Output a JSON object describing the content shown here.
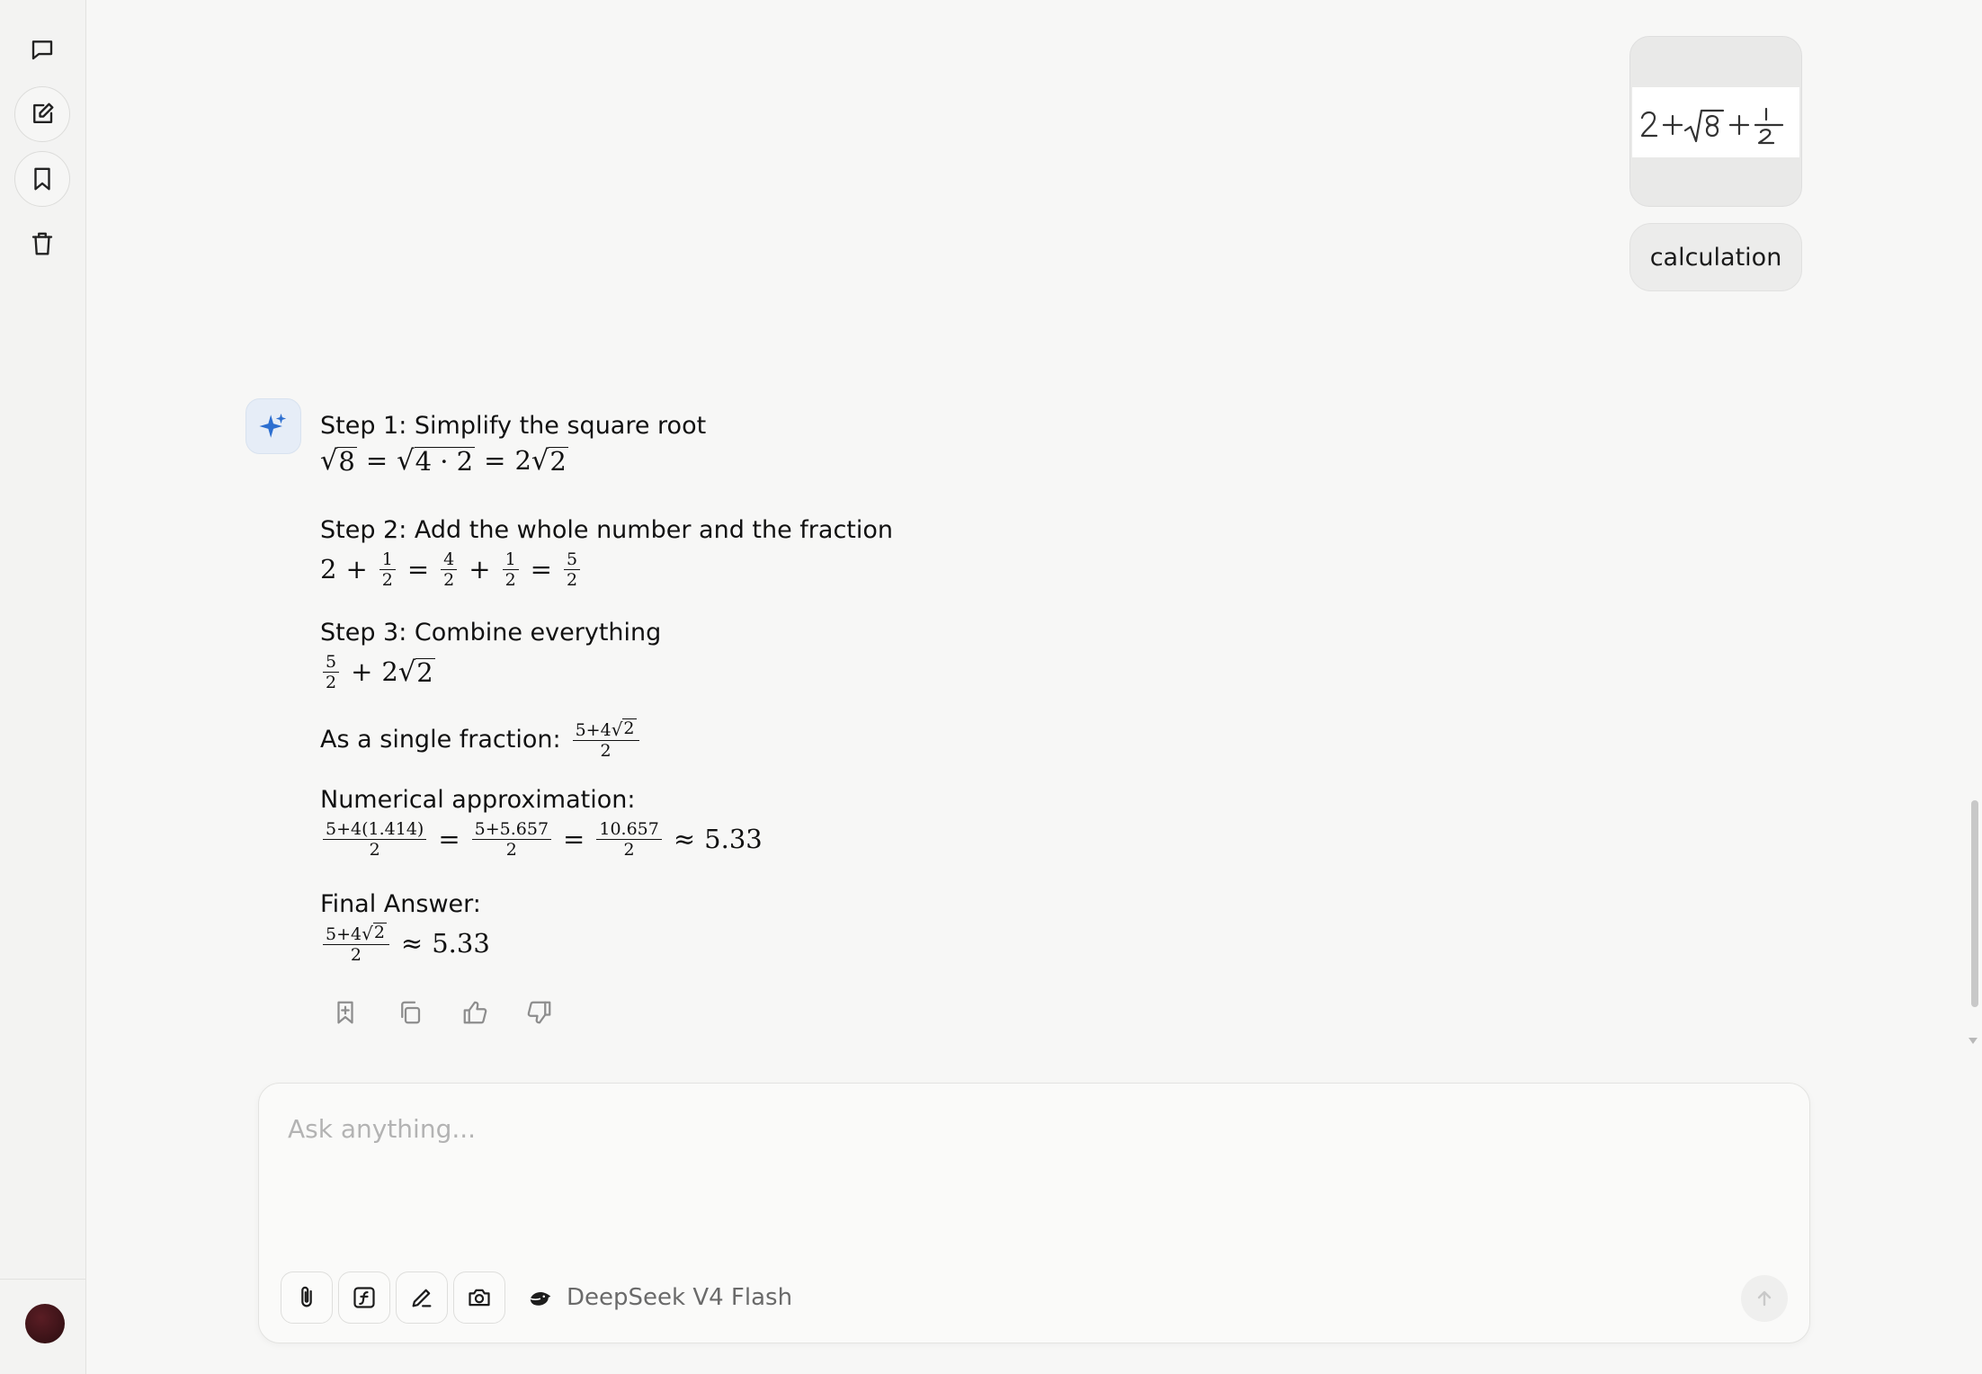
{
  "sidebar": {
    "icons": [
      "chat-icon",
      "new-chat-icon",
      "bookmark-icon",
      "trash-icon"
    ],
    "avatar_color": "#3a1117"
  },
  "user_message": {
    "image_alt": "handwritten expression",
    "text": "calculation"
  },
  "assistant": {
    "steps": [
      {
        "title": "Step 1: Simplify the square root"
      },
      {
        "title": "Step 2: Add the whole number and the fraction"
      },
      {
        "title": "Step 3: Combine everything"
      },
      {
        "title": "As a single fraction:"
      },
      {
        "title": "Numerical approximation:"
      },
      {
        "title": "Final Answer:"
      }
    ],
    "math": {
      "s1": {
        "a": "8",
        "b": "4 · 2",
        "c": "2",
        "d": "2"
      },
      "s2": {
        "whole": "2",
        "f1n": "1",
        "f1d": "2",
        "f2n": "4",
        "f2d": "2",
        "f3n": "1",
        "f3d": "2",
        "f4n": "5",
        "f4d": "2"
      },
      "s3": {
        "fn": "5",
        "fd": "2",
        "coef": "2",
        "rad": "2"
      },
      "s4": {
        "num_a": "5+4",
        "num_rad": "2",
        "den": "2"
      },
      "s5": {
        "n1": "5+4(1.414)",
        "d1": "2",
        "n2": "5+5.657",
        "d2": "2",
        "n3": "10.657",
        "d3": "2",
        "approx": "5.33"
      },
      "s6": {
        "num_a": "5+4",
        "num_rad": "2",
        "den": "2",
        "approx": "5.33"
      }
    },
    "actions": [
      "bookmark-add-icon",
      "copy-icon",
      "thumbs-up-icon",
      "thumbs-down-icon"
    ]
  },
  "composer": {
    "placeholder": "Ask anything...",
    "tools": [
      "attach-icon",
      "formula-icon",
      "pen-icon",
      "camera-icon"
    ],
    "model_name": "DeepSeek V4 Flash"
  },
  "colors": {
    "accent": "#2d6fd0",
    "background": "#f7f7f6"
  }
}
